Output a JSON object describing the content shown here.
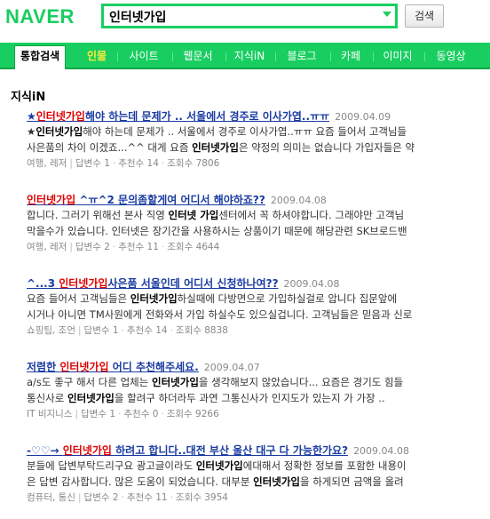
{
  "brand": {
    "logo": "NAVER",
    "accent": "#19ce60"
  },
  "search": {
    "query": "인터넷가입",
    "button_label": "검색"
  },
  "nav": {
    "tabs": [
      {
        "label": "통합검색"
      },
      {
        "label": "인물"
      },
      {
        "label": "사이트"
      },
      {
        "label": "웹문서"
      },
      {
        "label": "지식iN"
      },
      {
        "label": "블로그"
      },
      {
        "label": "카페"
      },
      {
        "label": "이미지"
      },
      {
        "label": "동영상"
      }
    ]
  },
  "section": {
    "title": "지식iN"
  },
  "results": [
    {
      "title_pre": "★",
      "title_hl": "인터넷가입",
      "title_post": "해야 하는데 문제가 .. 서울에서 경주로 이사가엽..ㅠㅠ",
      "date": "2009.04.09",
      "line1_pre": "★",
      "line1_b": "인터넷가입",
      "line1_post": "해야 하는데 문제가 .. 서울에서 경주로 이사가엽..ㅠㅠ 요즘 들어서 고객님들",
      "line2_pre": "사은품의 차이 이겠죠...^^ 대게 요즘 ",
      "line2_b": "인터넷가입",
      "line2_post": "은 약정의 의미는 없습니다 가입자들은 약",
      "meta": [
        "여행, 레저",
        "답변수 1",
        "추천수 14",
        "조회수 7806"
      ]
    },
    {
      "title_pre": "",
      "title_hl": "인터넷가입",
      "title_post": " ^ㅠ^2 문의좀할게여 어디서 해야하죠??",
      "date": "2009.04.08",
      "line1_pre": "합니다. 그러기 위해선 본사 직영 ",
      "line1_b": "인터넷 가입",
      "line1_post": "센터에서 꼭 하셔야합니다. 그래야만 고객님",
      "line2_pre": "막을수가 있습니다. 인터넷은 장기간을 사용하시는 상품이기 때문에 해당관련 SK브로드밴",
      "line2_b": "",
      "line2_post": "",
      "meta": [
        "여행, 레저",
        "답변수 2",
        "추천수 11",
        "조회수 4644"
      ]
    },
    {
      "title_pre": "^...3 ",
      "title_hl": "인터넷가입",
      "title_post": "사은품 서울인데 어디서 신청하나여??",
      "date": "2009.04.08",
      "line1_pre": "요즘 들어서 고객님들은 ",
      "line1_b": "인터넷가입",
      "line1_post": "하실때에 다방면으로 가입하실걸로 압니다 집문앞에",
      "line2_pre": "시거나 아니면 TM사원에게 전화와서 가입 하실수도 있으실겁니다. 고객님들은 믿음과 신로",
      "line2_b": "",
      "line2_post": "",
      "meta": [
        "쇼핑팁, 조언",
        "답변수 1",
        "추천수 14",
        "조회수 8838"
      ]
    },
    {
      "title_pre": "저렴한 ",
      "title_hl": "인터넷가입",
      "title_post": " 어디 추천해주세요.",
      "date": "2009.04.07",
      "line1_pre": "a/s도 좋구 해서 다른 업체는 ",
      "line1_b": "인터넷가입",
      "line1_post": "을 생각해보지 않았습니다... 요즘은 경기도 힘들",
      "line2_pre": "통신사로 ",
      "line2_b": "인터넷가입",
      "line2_post": "을 할려구 하더라두 과연 그통신사가 인지도가 있는지 가 가장 ..",
      "meta": [
        "IT 비지니스",
        "답변수 1",
        "추천수 0",
        "조회수 9266"
      ]
    },
    {
      "title_pre": "-♡♡→ ",
      "title_hl": "인터넷가입",
      "title_post": " 하려고 합니다..대전 부산 울산 대구 다 가능한가요?",
      "date": "2009.04.08",
      "line1_pre": "분들에 답변부탁드리구요 광고글이라도 ",
      "line1_b": "인터넷가입",
      "line1_post": "에대해서 정확한 정보를 포함한 내용이",
      "line2_pre": "은 답변 감사합니다. 많은 도움이 되었습니다. 대부분 ",
      "line2_b": "인터넷가입",
      "line2_post": "을 하게되면 금액을 올려",
      "meta": [
        "컴퓨터, 통신",
        "답변수 2",
        "추천수 11",
        "조회수 3954"
      ]
    }
  ]
}
